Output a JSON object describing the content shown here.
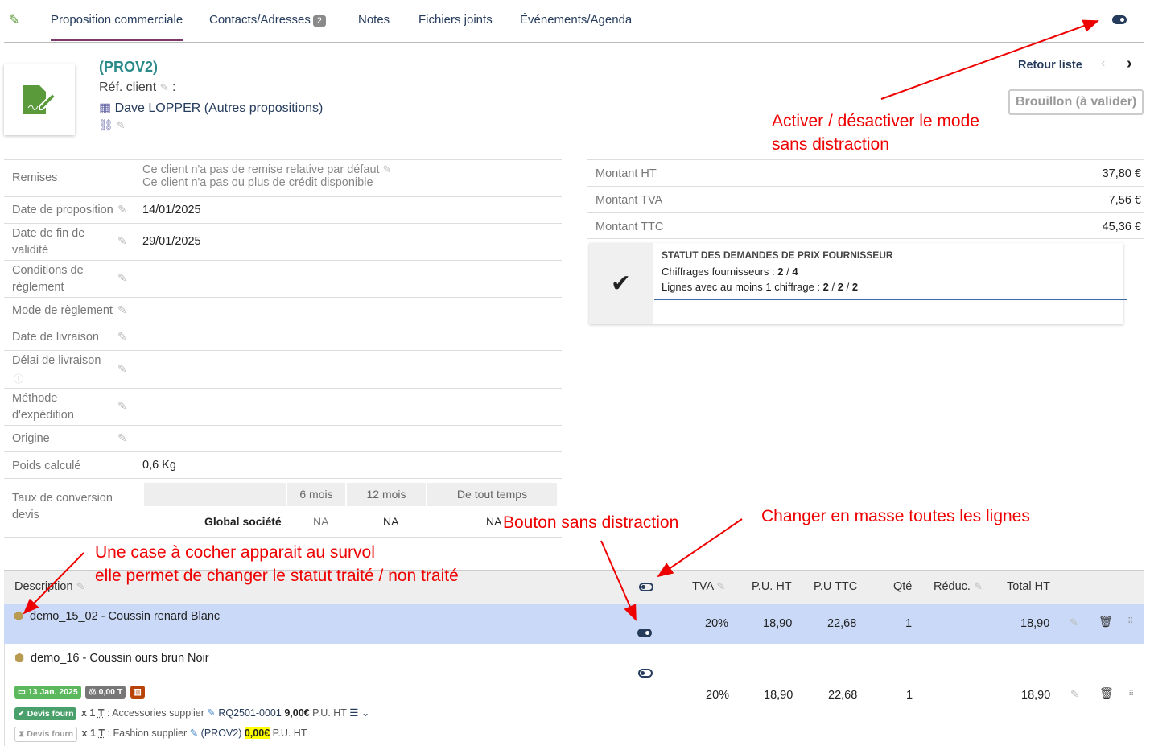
{
  "tabs": [
    {
      "label": "Proposition commerciale"
    },
    {
      "label": "Contacts/Adresses",
      "badge": "2"
    },
    {
      "label": "Notes"
    },
    {
      "label": "Fichiers joints"
    },
    {
      "label": "Événements/Agenda"
    }
  ],
  "header": {
    "ref": "(PROV2)",
    "ref_client_label": "Réf. client",
    "ref_client_sep": ":",
    "customer": "Dave LOPPER (Autres propositions)",
    "back": "Retour liste",
    "status": "Brouillon (à valider)"
  },
  "fields": [
    {
      "label": "Remises",
      "value": "Ce client n'a pas de remise relative par défaut",
      "value2": "Ce client n'a pas ou plus de crédit disponible"
    },
    {
      "label": "Date de proposition",
      "value": "14/01/2025"
    },
    {
      "label": "Date de fin de validité",
      "value": "29/01/2025"
    },
    {
      "label": "Conditions de règlement",
      "value": ""
    },
    {
      "label": "Mode de règlement",
      "value": ""
    },
    {
      "label": "Date de livraison",
      "value": ""
    },
    {
      "label": "Délai de livraison",
      "value": ""
    },
    {
      "label": "Méthode d'expédition",
      "value": ""
    },
    {
      "label": "Origine",
      "value": ""
    },
    {
      "label": "Poids calculé",
      "value": "0,6 Kg"
    }
  ],
  "conversion": {
    "label": "Taux de conversion devis",
    "cols": [
      "6 mois",
      "12 mois",
      "De tout temps"
    ],
    "row_label": "Global société",
    "values": [
      "NA",
      "NA",
      "NA"
    ]
  },
  "amounts": [
    {
      "label": "Montant HT",
      "value": "37,80 €"
    },
    {
      "label": "Montant TVA",
      "value": "7,56 €"
    },
    {
      "label": "Montant TTC",
      "value": "45,36 €"
    }
  ],
  "supplier_box": {
    "title": "STATUT DES DEMANDES DE PRIX FOURNISSEUR",
    "line1_label": "Chiffrages fournisseurs :",
    "line1_a": "2",
    "line1_b": "4",
    "line2_label": "Lignes avec au moins 1 chiffrage :",
    "line2_a": "2",
    "line2_b": "2",
    "line2_c": "2"
  },
  "table": {
    "headers": [
      "Description",
      "TVA",
      "P.U. HT",
      "P.U TTC",
      "Qté",
      "Réduc.",
      "Total HT"
    ],
    "rows": [
      {
        "desc": "demo_15_02 - Coussin renard Blanc",
        "tva": "20%",
        "puht": "18,90",
        "puttc": "22,68",
        "qty": "1",
        "total": "18,90"
      },
      {
        "desc": "demo_16 - Coussin ours brun Noir",
        "tva": "20%",
        "puht": "18,90",
        "puttc": "22,68",
        "qty": "1",
        "total": "18,90",
        "date_tag": "13 Jan. 2025",
        "weight_tag": "0,00 T",
        "q1": {
          "tag": "Devis fourn",
          "qty": "x 1",
          "unit": "T",
          "supplier": ": Accessories supplier",
          "ref": "RQ2501-0001",
          "price": "9,00€",
          "suffix": "P.U. HT"
        },
        "q2": {
          "tag": "Devis fourn",
          "qty": "x 1",
          "unit": "T",
          "supplier": ": Fashion supplier",
          "ref": "(PROV2)",
          "price": "0,00€",
          "suffix": "P.U. HT"
        }
      }
    ]
  },
  "annotations": {
    "a1_l1": "Activer / désactiver le mode",
    "a1_l2": "sans distraction",
    "a2": "Bouton sans distraction",
    "a3": "Changer en masse toutes les lignes",
    "a4_l1": "Une case à cocher apparait au survol",
    "a4_l2": "elle permet de changer le statut traité / non traité"
  },
  "colors": {
    "accent": "#263c5c",
    "annotation": "#e00000",
    "highlight": "#cad9f7"
  }
}
